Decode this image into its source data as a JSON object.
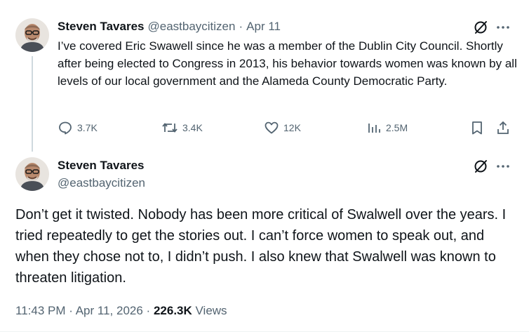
{
  "tweet1": {
    "display_name": "Steven Tavares",
    "handle": "@eastbaycitizen",
    "separator": "·",
    "date": "Apr 11",
    "text": "I’ve covered Eric Swawell since he was a member of the Dublin City Council. Shortly after being elected to Congress in 2013, his behavior towards women was known by all levels of our local government and the Alameda County Democratic Party.",
    "actions": {
      "replies": "3.7K",
      "reposts": "3.4K",
      "likes": "12K",
      "views": "2.5M"
    }
  },
  "tweet2": {
    "display_name": "Steven Tavares",
    "handle": "@eastbaycitizen",
    "text": "Don’t get it twisted. Nobody has been more critical of Swalwell over the years. I tried repeatedly to get the stories out. I can’t force women to speak out, and when they chose not to, I didn’t push. I also knew that Swalwell was known to threaten litigation.",
    "time": "11:43 PM",
    "dot": "·",
    "date": "Apr 11, 2026",
    "views_count": "226.3K",
    "views_label": "Views"
  },
  "icons": {
    "grok": "grok-icon",
    "more": "more-icon",
    "reply": "reply-icon",
    "repost": "repost-icon",
    "like": "like-icon",
    "views": "views-icon",
    "bookmark": "bookmark-icon",
    "share": "share-icon"
  },
  "colors": {
    "text": "#0f1419",
    "secondary": "#536471",
    "thread_line": "#cfd9de"
  }
}
